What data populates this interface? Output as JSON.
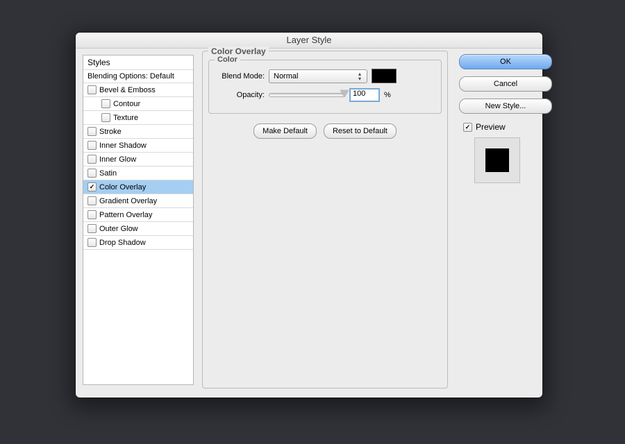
{
  "dialog_title": "Layer Style",
  "sidebar": {
    "header": "Styles",
    "blending": "Blending Options: Default",
    "items": [
      {
        "label": "Bevel & Emboss",
        "checked": false,
        "indent": 0
      },
      {
        "label": "Contour",
        "checked": false,
        "indent": 1
      },
      {
        "label": "Texture",
        "checked": false,
        "indent": 1
      },
      {
        "label": "Stroke",
        "checked": false,
        "indent": 0
      },
      {
        "label": "Inner Shadow",
        "checked": false,
        "indent": 0
      },
      {
        "label": "Inner Glow",
        "checked": false,
        "indent": 0
      },
      {
        "label": "Satin",
        "checked": false,
        "indent": 0
      },
      {
        "label": "Color Overlay",
        "checked": true,
        "indent": 0,
        "selected": true
      },
      {
        "label": "Gradient Overlay",
        "checked": false,
        "indent": 0
      },
      {
        "label": "Pattern Overlay",
        "checked": false,
        "indent": 0
      },
      {
        "label": "Outer Glow",
        "checked": false,
        "indent": 0
      },
      {
        "label": "Drop Shadow",
        "checked": false,
        "indent": 0
      }
    ]
  },
  "main": {
    "section_title": "Color Overlay",
    "group_title": "Color",
    "blend_mode_label": "Blend Mode:",
    "blend_mode_value": "Normal",
    "opacity_label": "Opacity:",
    "opacity_value": "100",
    "opacity_unit": "%",
    "color_swatch": "#000000",
    "make_default": "Make Default",
    "reset_default": "Reset to Default"
  },
  "buttons": {
    "ok": "OK",
    "cancel": "Cancel",
    "new_style": "New Style...",
    "preview": "Preview"
  },
  "preview_color": "#000000"
}
